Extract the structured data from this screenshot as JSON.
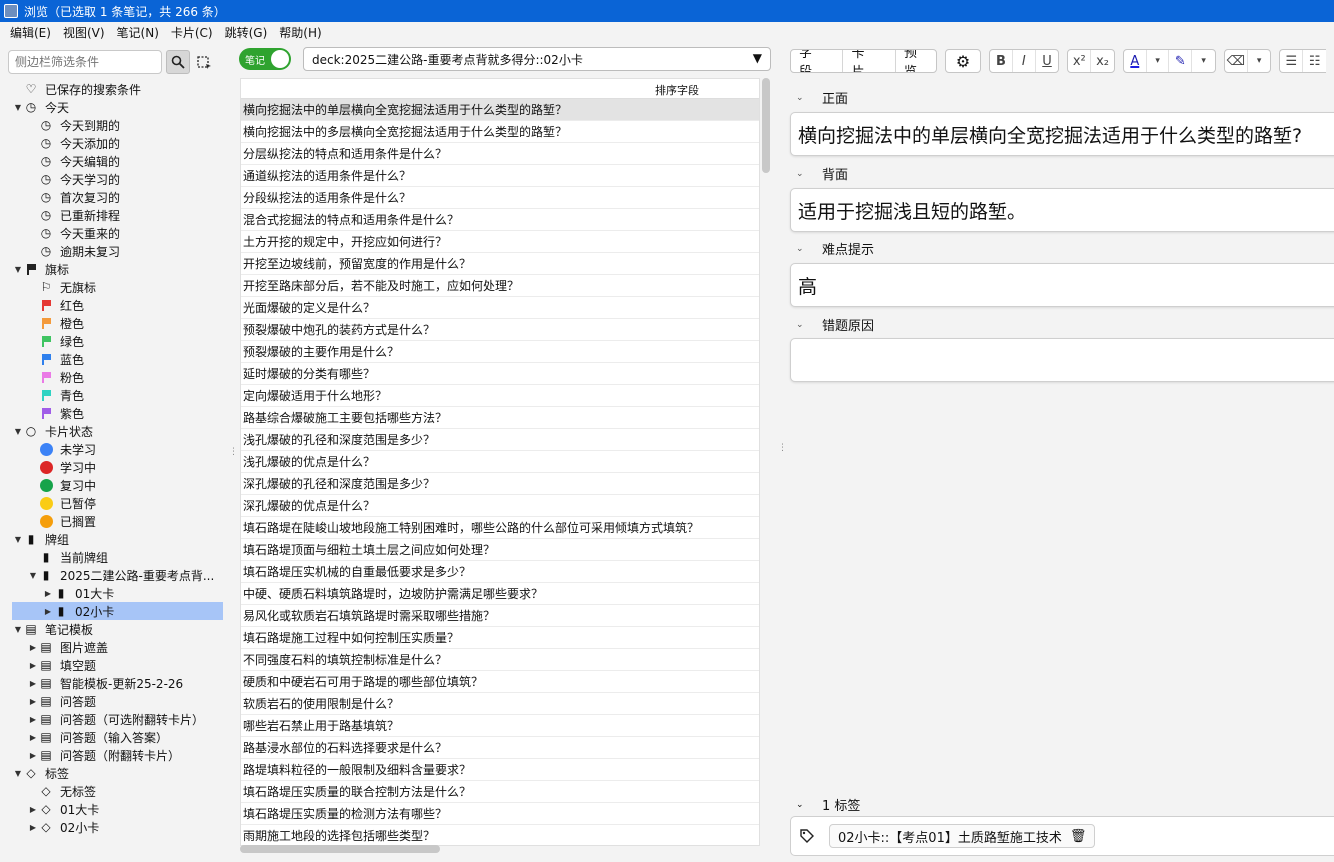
{
  "window": {
    "title": "浏览（已选取 1 条笔记，共 266 条）"
  },
  "menu": [
    "编辑(E)",
    "视图(V)",
    "笔记(N)",
    "卡片(C)",
    "跳转(G)",
    "帮助(H)"
  ],
  "sidebar": {
    "search_placeholder": "侧边栏筛选条件",
    "items": [
      {
        "level": 0,
        "arrow": "",
        "icon": "heart-icon",
        "glyph": "♡",
        "label": "已保存的搜索条件"
      },
      {
        "level": 0,
        "arrow": "down",
        "icon": "clock-icon",
        "glyph": "◷",
        "label": "今天"
      },
      {
        "level": 1,
        "arrow": "",
        "icon": "clock-icon",
        "glyph": "◷",
        "label": "今天到期的"
      },
      {
        "level": 1,
        "arrow": "",
        "icon": "clock-icon",
        "glyph": "◷",
        "label": "今天添加的"
      },
      {
        "level": 1,
        "arrow": "",
        "icon": "clock-icon",
        "glyph": "◷",
        "label": "今天编辑的"
      },
      {
        "level": 1,
        "arrow": "",
        "icon": "clock-icon",
        "glyph": "◷",
        "label": "今天学习的"
      },
      {
        "level": 1,
        "arrow": "",
        "icon": "clock-icon",
        "glyph": "◷",
        "label": "首次复习的"
      },
      {
        "level": 1,
        "arrow": "",
        "icon": "clock-icon",
        "glyph": "◷",
        "label": "已重新排程"
      },
      {
        "level": 1,
        "arrow": "",
        "icon": "clock-icon",
        "glyph": "◷",
        "label": "今天重来的"
      },
      {
        "level": 1,
        "arrow": "",
        "icon": "clock-icon",
        "glyph": "◷",
        "label": "逾期未复习"
      },
      {
        "level": 0,
        "arrow": "down",
        "icon": "flag-icon",
        "flag": "#222222",
        "label": "旗标"
      },
      {
        "level": 1,
        "arrow": "",
        "icon": "no-flag-icon",
        "glyph": "⚐",
        "label": "无旗标"
      },
      {
        "level": 1,
        "arrow": "",
        "icon": "red-flag-icon",
        "flag": "#e53935",
        "label": "红色"
      },
      {
        "level": 1,
        "arrow": "",
        "icon": "orange-flag-icon",
        "flag": "#f39a3c",
        "label": "橙色"
      },
      {
        "level": 1,
        "arrow": "",
        "icon": "green-flag-icon",
        "flag": "#3fc462",
        "label": "绿色"
      },
      {
        "level": 1,
        "arrow": "",
        "icon": "blue-flag-icon",
        "flag": "#2f80ed",
        "label": "蓝色"
      },
      {
        "level": 1,
        "arrow": "",
        "icon": "pink-flag-icon",
        "flag": "#ea7ae6",
        "label": "粉色"
      },
      {
        "level": 1,
        "arrow": "",
        "icon": "turquoise-flag-icon",
        "flag": "#2ed3c3",
        "label": "青色"
      },
      {
        "level": 1,
        "arrow": "",
        "icon": "purple-flag-icon",
        "flag": "#a05de8",
        "label": "紫色"
      },
      {
        "level": 0,
        "arrow": "down",
        "icon": "circle-icon",
        "glyph": "○",
        "label": "卡片状态"
      },
      {
        "level": 1,
        "arrow": "",
        "icon": "new-dot-icon",
        "dot": "#3b82f6",
        "label": "未学习"
      },
      {
        "level": 1,
        "arrow": "",
        "icon": "learn-dot-icon",
        "dot": "#dc2626",
        "label": "学习中"
      },
      {
        "level": 1,
        "arrow": "",
        "icon": "review-dot-icon",
        "dot": "#16a34a",
        "label": "复习中"
      },
      {
        "level": 1,
        "arrow": "",
        "icon": "suspended-dot-icon",
        "dot": "#facc15",
        "label": "已暂停"
      },
      {
        "level": 1,
        "arrow": "",
        "icon": "buried-dot-icon",
        "dot": "#f59e0b",
        "label": "已搁置"
      },
      {
        "level": 0,
        "arrow": "down",
        "icon": "deck-icon",
        "glyph": "▮",
        "label": "牌组"
      },
      {
        "level": 1,
        "arrow": "",
        "icon": "deck-icon",
        "glyph": "▮",
        "label": "当前牌组"
      },
      {
        "level": 1,
        "arrow": "down",
        "icon": "deck-icon",
        "glyph": "▮",
        "label": "2025二建公路-重要考点背..."
      },
      {
        "level": 2,
        "arrow": "right",
        "icon": "deck-icon",
        "glyph": "▮",
        "label": "01大卡"
      },
      {
        "level": 2,
        "arrow": "right",
        "icon": "deck-icon",
        "glyph": "▮",
        "label": "02小卡",
        "selected": true
      },
      {
        "level": 0,
        "arrow": "down",
        "icon": "note-type-icon",
        "glyph": "▤",
        "label": "笔记模板"
      },
      {
        "level": 1,
        "arrow": "right",
        "icon": "note-type-icon",
        "glyph": "▤",
        "label": "图片遮盖"
      },
      {
        "level": 1,
        "arrow": "right",
        "icon": "note-type-icon",
        "glyph": "▤",
        "label": "填空题"
      },
      {
        "level": 1,
        "arrow": "right",
        "icon": "note-type-icon",
        "glyph": "▤",
        "label": "智能模板-更新25-2-26"
      },
      {
        "level": 1,
        "arrow": "right",
        "icon": "note-type-icon",
        "glyph": "▤",
        "label": "问答题"
      },
      {
        "level": 1,
        "arrow": "right",
        "icon": "note-type-icon",
        "glyph": "▤",
        "label": "问答题（可选附翻转卡片）"
      },
      {
        "level": 1,
        "arrow": "right",
        "icon": "note-type-icon",
        "glyph": "▤",
        "label": "问答题（输入答案）"
      },
      {
        "level": 1,
        "arrow": "right",
        "icon": "note-type-icon",
        "glyph": "▤",
        "label": "问答题（附翻转卡片）"
      },
      {
        "level": 0,
        "arrow": "down",
        "icon": "tag-icon",
        "glyph": "◇",
        "label": "标签"
      },
      {
        "level": 1,
        "arrow": "",
        "icon": "no-tag-icon",
        "glyph": "◇",
        "label": "无标签"
      },
      {
        "level": 1,
        "arrow": "right",
        "icon": "tag-icon",
        "glyph": "◇",
        "label": "01大卡"
      },
      {
        "level": 1,
        "arrow": "right",
        "icon": "tag-icon",
        "glyph": "◇",
        "label": "02小卡"
      }
    ]
  },
  "browser": {
    "toggle_label": "笔记",
    "search_text": "deck:2025二建公路-重要考点背就多得分::02小卡",
    "column_header": "排序字段",
    "rows": [
      "横向挖掘法中的单层横向全宽挖掘法适用于什么类型的路堑？",
      "横向挖掘法中的多层横向全宽挖掘法适用于什么类型的路堑？",
      "分层纵挖法的特点和适用条件是什么？",
      "通道纵挖法的适用条件是什么？",
      "分段纵挖法的适用条件是什么？",
      "混合式挖掘法的特点和适用条件是什么？",
      "土方开挖的规定中，开挖应如何进行？",
      "开挖至边坡线前，预留宽度的作用是什么？",
      "开挖至路床部分后，若不能及时施工，应如何处理？",
      "光面爆破的定义是什么？",
      "预裂爆破中炮孔的装药方式是什么？",
      "预裂爆破的主要作用是什么？",
      "延时爆破的分类有哪些？",
      "定向爆破适用于什么地形？",
      "路基综合爆破施工主要包括哪些方法？",
      "浅孔爆破的孔径和深度范围是多少？",
      "浅孔爆破的优点是什么？",
      "深孔爆破的孔径和深度范围是多少？",
      "深孔爆破的优点是什么？",
      "填石路堤在陡峻山坡地段施工特别困难时，哪些公路的什么部位可采用倾填方式填筑？",
      "填石路堤顶面与细粒土填土层之间应如何处理？",
      "填石路堤压实机械的自重最低要求是多少？",
      "中硬、硬质石料填筑路堤时，边坡防护需满足哪些要求？",
      "易风化或软质岩石填筑路堤时需采取哪些措施？",
      "填石路堤施工过程中如何控制压实质量？",
      "不同强度石料的填筑控制标准是什么？",
      "硬质和中硬岩石可用于路堤的哪些部位填筑？",
      "软质岩石的使用限制是什么？",
      "哪些岩石禁止用于路基填筑？",
      "路基浸水部位的石料选择要求是什么？",
      "路堤填料粒径的一般限制及细料含量要求？",
      "填石路堤压实质量的联合控制方法是什么？",
      "填石路堤压实质量的检测方法有哪些？",
      "雨期施工地段的选择包括哪些类型？"
    ]
  },
  "editor": {
    "buttons": [
      "字段...",
      "卡片...",
      "预览"
    ],
    "format": [
      "B",
      "I",
      "U",
      "x²",
      "x₂",
      "A",
      "✎",
      "⌫",
      "☰",
      "☷"
    ],
    "fields": [
      {
        "label": "正面",
        "value": "横向挖掘法中的单层横向全宽挖掘法适用于什么类型的路堑?"
      },
      {
        "label": "背面",
        "value": "适用于挖掘浅且短的路堑。"
      },
      {
        "label": "难点提示",
        "value": "高"
      },
      {
        "label": "错题原因",
        "value": ""
      }
    ],
    "tags_label": "1 标签",
    "tag": "02小卡::【考点01】土质路堑施工技术"
  }
}
